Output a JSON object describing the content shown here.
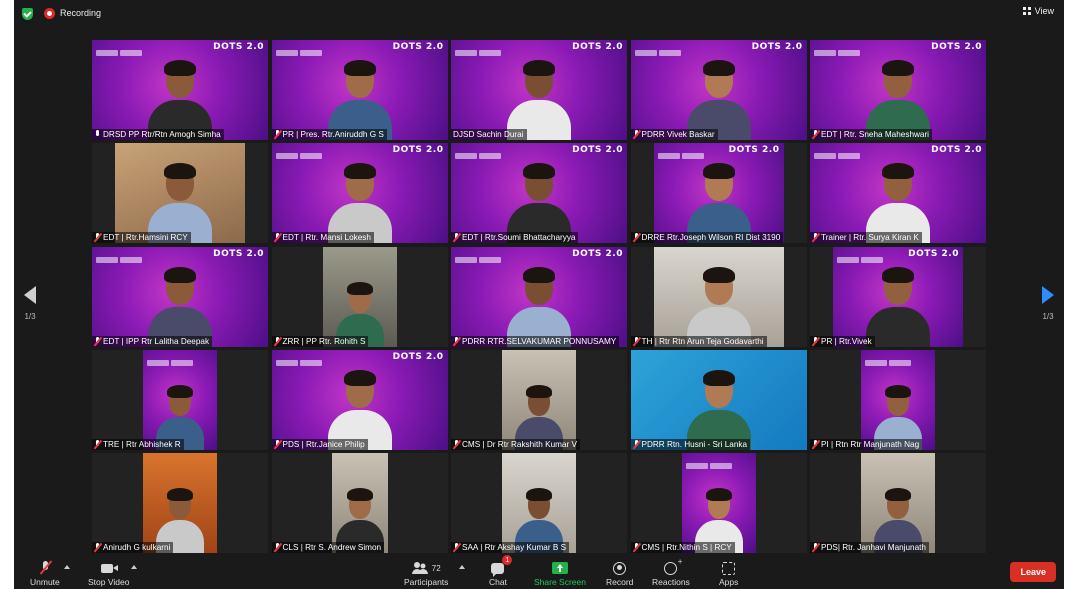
{
  "topbar": {
    "recording_label": "Recording",
    "view_label": "View"
  },
  "pager": {
    "left_label": "1/3",
    "right_label": "1/3"
  },
  "participants": [
    {
      "name": "DRSD PP Rtr/Rtn Amogh Simha",
      "muted": false,
      "background": "purple",
      "active_speaker": true
    },
    {
      "name": "PR | Pres. Rtr.Aniruddh G S",
      "muted": true,
      "background": "purple"
    },
    {
      "name": "DJSD Sachin Durai",
      "muted": false,
      "background": "purple",
      "no_icon": true
    },
    {
      "name": "PDRR Vivek Baskar",
      "muted": true,
      "background": "purple"
    },
    {
      "name": "EDT | Rtr. Sneha Maheshwari",
      "muted": true,
      "background": "purple"
    },
    {
      "name": "EDT | Rtr.Hamsini RCY",
      "muted": true,
      "background": "wall"
    },
    {
      "name": "EDT | Rtr. Mansi Lokesh",
      "muted": true,
      "background": "purple"
    },
    {
      "name": "EDT | Rtr.Soumi Bhattacharyya",
      "muted": true,
      "background": "purple"
    },
    {
      "name": "DRRE Rtr.Joseph Wilson RI Dist 3190",
      "muted": true,
      "background": "purple"
    },
    {
      "name": "Trainer | Rtr. Surya Kiran K",
      "muted": true,
      "background": "purple"
    },
    {
      "name": "EDT | IPP Rtr Lalitha Deepak",
      "muted": true,
      "background": "purple"
    },
    {
      "name": "ZRR | PP Rtr. Rohith S",
      "muted": true,
      "background": "indoor"
    },
    {
      "name": "PDRR RTR.SELVAKUMAR PONNUSAMY",
      "muted": true,
      "background": "purple"
    },
    {
      "name": "TH | Rtr Rtn Arun Teja Godavarthi",
      "muted": true,
      "background": "outdoor"
    },
    {
      "name": "PR | Rtr.Vivek",
      "muted": true,
      "background": "purple"
    },
    {
      "name": "TRE | Rtr Abhishek R",
      "muted": true,
      "background": "purple"
    },
    {
      "name": "PDS | Rtr.Janice Philip",
      "muted": true,
      "background": "purple"
    },
    {
      "name": "CMS | Dr Rtr Rakshith Kumar V",
      "muted": true,
      "background": "room"
    },
    {
      "name": "PDRR Rtn. Husni - Sri Lanka",
      "muted": true,
      "background": "blue"
    },
    {
      "name": "PI | Rtn Rtr Manjunath Nag",
      "muted": true,
      "background": "purple"
    },
    {
      "name": "Anirudh G kulkarni",
      "muted": true,
      "background": "orange"
    },
    {
      "name": "CLS | Rtr S. Andrew Simon",
      "muted": true,
      "background": "room"
    },
    {
      "name": "SAA | Rtr Akshay Kumar B S",
      "muted": true,
      "background": "outdoor"
    },
    {
      "name": "CMS | Rtr.Nithin S | RCY",
      "muted": true,
      "background": "purple"
    },
    {
      "name": "PDS| Rtr. Janhavi Manjunath",
      "muted": true,
      "background": "room"
    }
  ],
  "virtual_background": {
    "brand_text": "DOTS 2.0",
    "rotary_text": "Rotary",
    "rotary_hashtag_1": "#RotaryResponds",
    "rotary_hashtag_2": "#PeopleofAction"
  },
  "toolbar": {
    "unmute_label": "Unmute",
    "stop_video_label": "Stop Video",
    "participants_label": "Participants",
    "participants_count": "72",
    "chat_label": "Chat",
    "chat_badge": "1",
    "share_label": "Share Screen",
    "record_label": "Record",
    "reactions_label": "Reactions",
    "apps_label": "Apps",
    "leave_label": "Leave"
  },
  "colors": {
    "active_speaker_border": "#e6d84a",
    "recording": "#e02828",
    "share_accent": "#22c55e",
    "leave": "#d93025",
    "pager_next": "#2d8cff"
  }
}
